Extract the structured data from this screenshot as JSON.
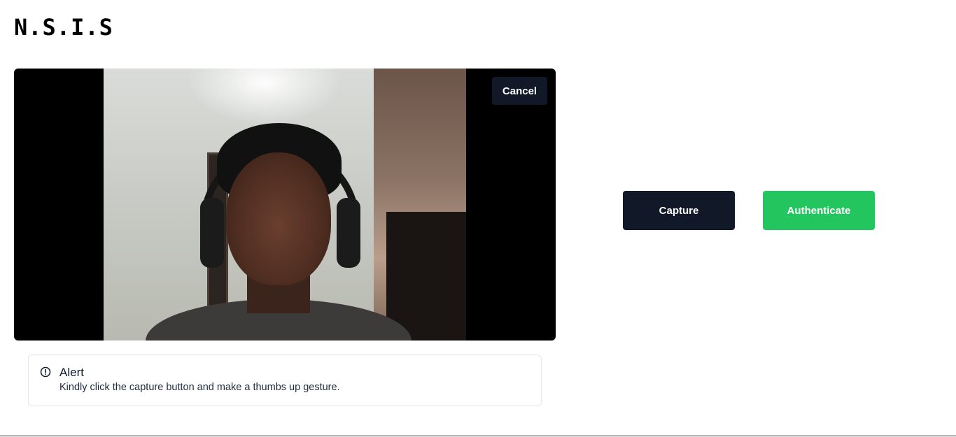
{
  "app": {
    "title": "N.S.I.S"
  },
  "camera": {
    "cancel_label": "Cancel"
  },
  "actions": {
    "capture_label": "Capture",
    "authenticate_label": "Authenticate"
  },
  "alert": {
    "title": "Alert",
    "message": "Kindly click the capture button and make a thumbs up gesture.",
    "icon": "alert-circle-icon"
  },
  "colors": {
    "primary_dark": "#111827",
    "success_green": "#22c55e",
    "border": "#e2e8f0"
  }
}
